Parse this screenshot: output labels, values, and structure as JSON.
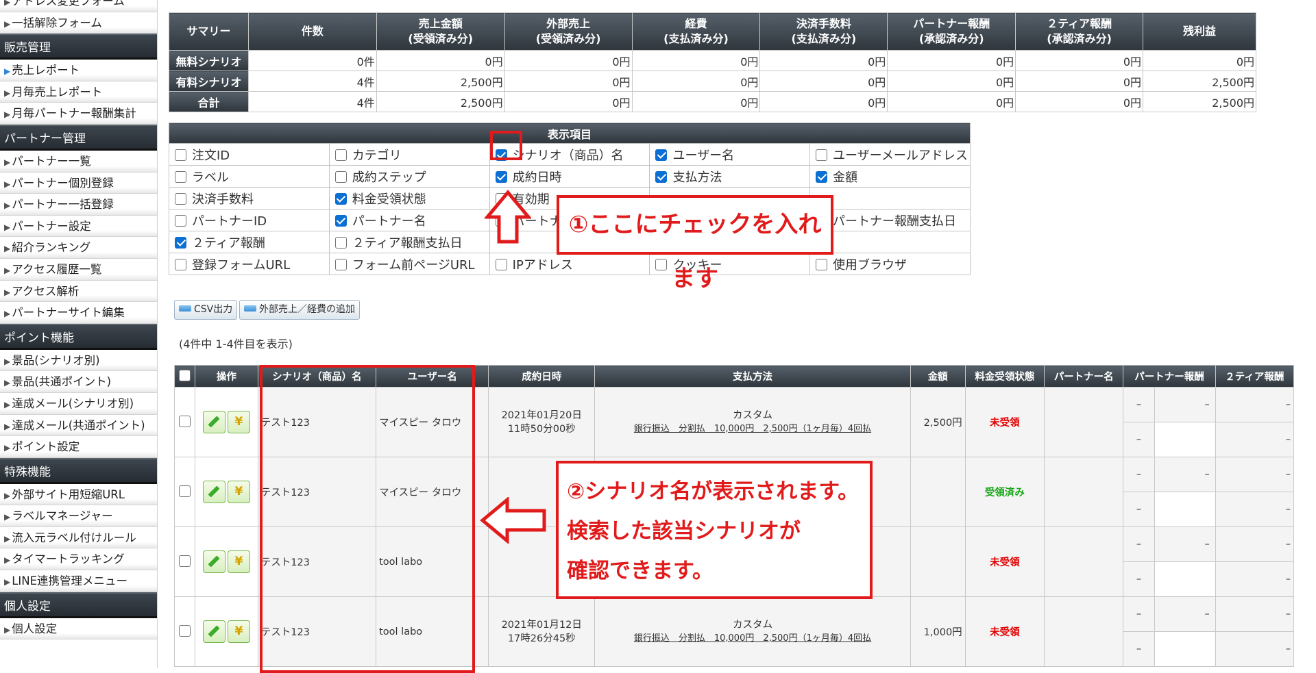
{
  "sidebar": {
    "top_items": [
      {
        "label": "アドレス変更フォーム"
      },
      {
        "label": "一括解除フォーム"
      }
    ],
    "sections": [
      {
        "title": "販売管理",
        "items": [
          {
            "label": "売上レポート",
            "active": true
          },
          {
            "label": "月毎売上レポート"
          },
          {
            "label": "月毎パートナー報酬集計"
          }
        ]
      },
      {
        "title": "パートナー管理",
        "items": [
          {
            "label": "パートナー一覧"
          },
          {
            "label": "パートナー個別登録"
          },
          {
            "label": "パートナー一括登録"
          },
          {
            "label": "パートナー設定"
          },
          {
            "label": "紹介ランキング"
          },
          {
            "label": "アクセス履歴一覧"
          },
          {
            "label": "アクセス解析"
          },
          {
            "label": "パートナーサイト編集"
          }
        ]
      },
      {
        "title": "ポイント機能",
        "items": [
          {
            "label": "景品(シナリオ別)"
          },
          {
            "label": "景品(共通ポイント)"
          },
          {
            "label": "達成メール(シナリオ別)"
          },
          {
            "label": "達成メール(共通ポイント)"
          },
          {
            "label": "ポイント設定"
          }
        ]
      },
      {
        "title": "特殊機能",
        "items": [
          {
            "label": "外部サイト用短縮URL"
          },
          {
            "label": "ラベルマネージャー"
          },
          {
            "label": "流入元ラベル付けルール"
          },
          {
            "label": "タイマートラッキング"
          },
          {
            "label": "LINE連携管理メニュー"
          }
        ]
      },
      {
        "title": "個人設定",
        "items": [
          {
            "label": "個人設定"
          }
        ]
      }
    ]
  },
  "summary": {
    "headers": [
      "サマリー",
      "件数",
      "売上金額\n(受領済み分)",
      "外部売上\n(受領済み分)",
      "経費\n(支払済み分)",
      "決済手数料\n(支払済み分)",
      "パートナー報酬\n(承認済み分)",
      "２ティア報酬\n(承認済み分)",
      "残利益"
    ],
    "rows": [
      {
        "label": "無料シナリオ",
        "values": [
          "0件",
          "0円",
          "0円",
          "0円",
          "0円",
          "0円",
          "0円",
          "0円"
        ]
      },
      {
        "label": "有料シナリオ",
        "values": [
          "4件",
          "2,500円",
          "0円",
          "0円",
          "0円",
          "0円",
          "0円",
          "2,500円"
        ]
      },
      {
        "label": "合計",
        "values": [
          "4件",
          "2,500円",
          "0円",
          "0円",
          "0円",
          "0円",
          "0円",
          "2,500円"
        ]
      }
    ]
  },
  "display_items": {
    "title": "表示項目",
    "rows": [
      [
        {
          "label": "注文ID",
          "checked": false
        },
        {
          "label": "カテゴリ",
          "checked": false
        },
        {
          "label": "シナリオ（商品）名",
          "checked": true
        },
        {
          "label": "ユーザー名",
          "checked": true
        },
        {
          "label": "ユーザーメールアドレス",
          "checked": false
        }
      ],
      [
        {
          "label": "ラベル",
          "checked": false
        },
        {
          "label": "成約ステップ",
          "checked": false
        },
        {
          "label": "成約日時",
          "checked": true
        },
        {
          "label": "支払方法",
          "checked": true
        },
        {
          "label": "金額",
          "checked": true
        }
      ],
      [
        {
          "label": "決済手数料",
          "checked": false
        },
        {
          "label": "料金受領状態",
          "checked": true
        },
        {
          "label": "有効期",
          "checked": false
        },
        {
          "label": "",
          "checked": false
        },
        {
          "label": "",
          "checked": false
        }
      ],
      [
        {
          "label": "パートナーID",
          "checked": false
        },
        {
          "label": "パートナー名",
          "checked": true
        },
        {
          "label": "パートナ",
          "checked": false
        },
        {
          "label": "",
          "checked": false
        },
        {
          "label": "パートナー報酬支払日",
          "checked": false
        }
      ],
      [
        {
          "label": "２ティア報酬",
          "checked": true
        },
        {
          "label": "２ティア報酬支払日",
          "checked": false
        },
        {
          "label": "",
          "checked": false
        },
        {
          "label": "",
          "checked": false
        },
        {
          "label": "",
          "checked": false
        }
      ],
      [
        {
          "label": "登録フォームURL",
          "checked": false
        },
        {
          "label": "フォーム前ページURL",
          "checked": false
        },
        {
          "label": "IPアドレス",
          "checked": false
        },
        {
          "label": "クッキー",
          "checked": false
        },
        {
          "label": "使用ブラウザ",
          "checked": false
        }
      ]
    ]
  },
  "buttons": {
    "csv": "CSV出力",
    "add_external": "外部売上／経費の追加"
  },
  "result_count": "(4件中 1-4件目を表示)",
  "orders": {
    "headers": [
      "操作",
      "シナリオ（商品）名",
      "ユーザー名",
      "成約日時",
      "支払方法",
      "金額",
      "料金受領状態",
      "パートナー名",
      "パートナー報酬",
      "２ティア報酬"
    ],
    "rows": [
      {
        "scenario": "テスト123",
        "user": "マイスピー タロウ",
        "date": "2021年01月20日\n11時50分00秒",
        "pay_type": "カスタム",
        "pay_detail": "銀行振込　分割払　10,000円　2,500円（1ヶ月毎）4回払",
        "amount": "2,500円",
        "status": "未受領",
        "status_color": "#e20000"
      },
      {
        "scenario": "テスト123",
        "user": "マイスピー タロウ",
        "date": "",
        "pay_type": "",
        "pay_detail": "",
        "amount": "",
        "status": "受領済み",
        "status_color": "#19a719"
      },
      {
        "scenario": "テスト123",
        "user": "tool labo",
        "date": "",
        "pay_type": "",
        "pay_detail": "",
        "amount": "",
        "status": "未受領",
        "status_color": "#e20000"
      },
      {
        "scenario": "テスト123",
        "user": "tool labo",
        "date": "2021年01月12日\n17時26分45秒",
        "pay_type": "カスタム",
        "pay_detail": "銀行振込　分割払　10,000円　2,500円（1ヶ月毎）4回払",
        "amount": "1,000円",
        "status": "未受領",
        "status_color": "#e20000"
      }
    ],
    "dash": "–",
    "op_pencil": "pencil-icon",
    "op_yen": "¥"
  },
  "annotations": {
    "a1": "①ここにチェックを入れます",
    "a2_line1": "②シナリオ名が表示されます。",
    "a2_line2": "検索した該当シナリオが",
    "a2_line3": "確認できます。",
    "color": "#e11b1b"
  }
}
